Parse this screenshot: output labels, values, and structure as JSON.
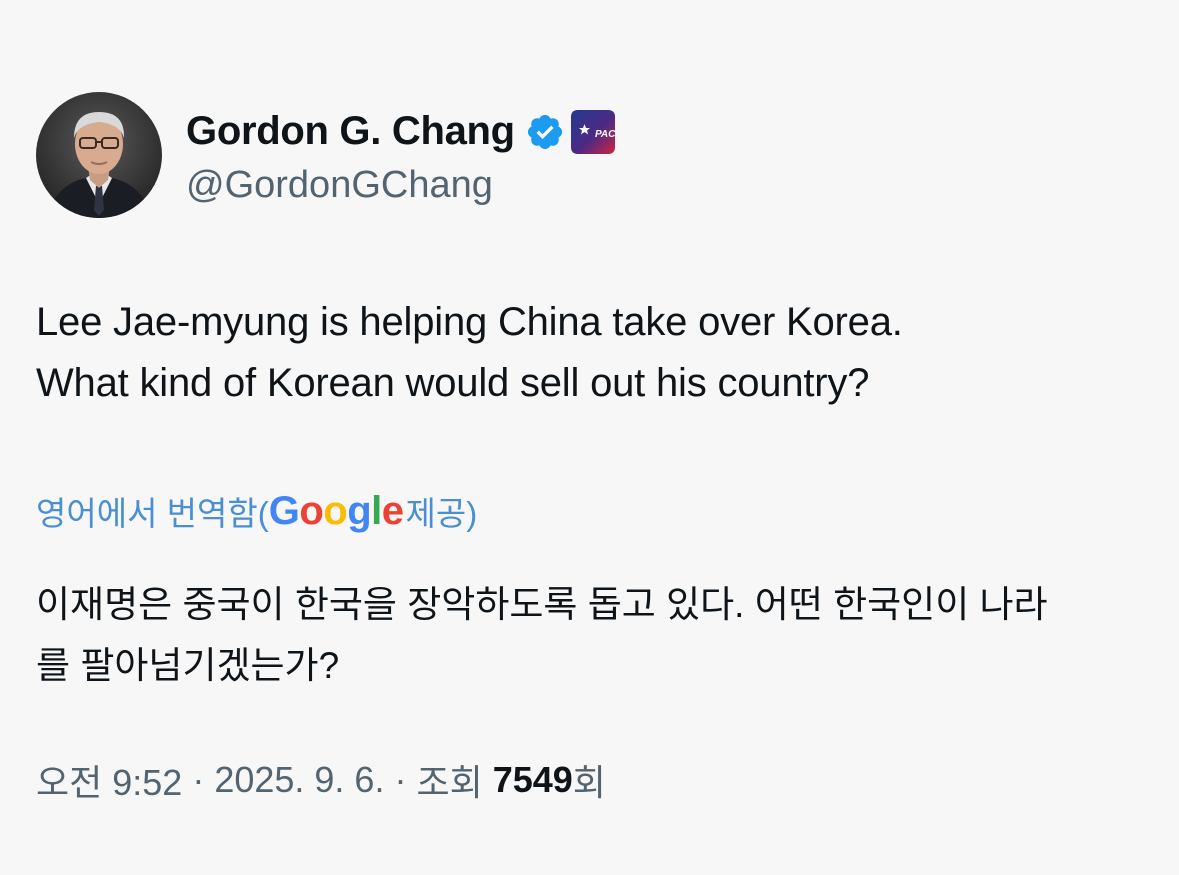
{
  "author": {
    "display_name": "Gordon G. Chang",
    "handle": "@GordonGChang",
    "verified_icon": "verified-badge-icon",
    "affiliation_icon": "cpac-affiliate-badge-icon",
    "avatar": "profile-photo"
  },
  "tweet": {
    "text_lines": [
      "Lee Jae-myung is helping China take over Korea.",
      "What kind of Korean would sell out his country?"
    ],
    "translation_label_prefix": "영어에서 번역함(",
    "translation_provider": "Google",
    "translation_label_suffix": " 제공)",
    "translated_lines": [
      "이재명은 중국이 한국을 장악하도록 돕고 있다. 어떤 한국인이 나라",
      "를 팔아넘기겠는가?"
    ]
  },
  "meta": {
    "time": "오전 9:52",
    "separator1": " · ",
    "date": "2025. 9. 6.",
    "separator2": " · ",
    "views_label": "조회 ",
    "views_count": "7549",
    "views_suffix": "회"
  },
  "colors": {
    "background": "#f7f7f7",
    "text": "#0f1419",
    "secondary": "#536471",
    "link": "#4a8fd1",
    "verified": "#1d9bf0"
  },
  "google_letters": [
    {
      "char": "G",
      "color": "#4285F4"
    },
    {
      "char": "o",
      "color": "#EA4335"
    },
    {
      "char": "o",
      "color": "#FBBC05"
    },
    {
      "char": "g",
      "color": "#4285F4"
    },
    {
      "char": "l",
      "color": "#34A853"
    },
    {
      "char": "e",
      "color": "#EA4335"
    }
  ]
}
